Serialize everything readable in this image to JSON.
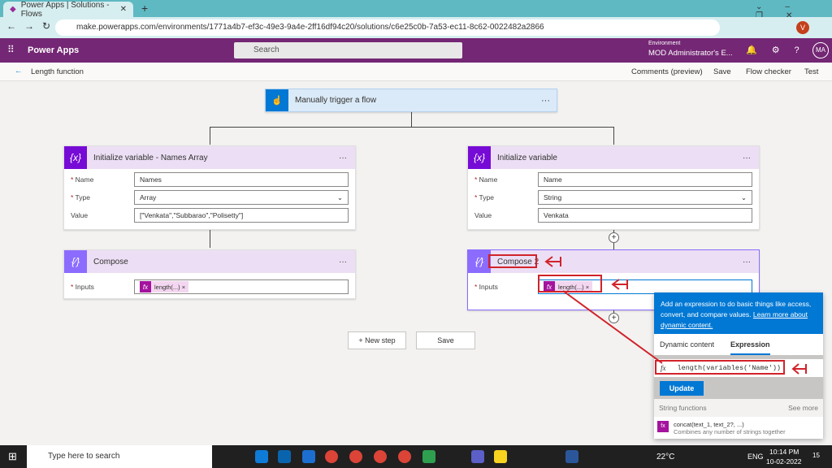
{
  "browser": {
    "tab_title": "Power Apps | Solutions - Flows",
    "url": "make.powerapps.com/environments/1771a4b7-ef3c-49e3-9a4e-2ff16df94c20/solutions/c6e25c0b-7a53-ec11-8c62-0022482a2866",
    "profile": "V"
  },
  "header": {
    "app": "Power Apps",
    "search_placeholder": "Search",
    "env_label": "Environment",
    "env_name": "MOD Administrator's E...",
    "avatar": "MA"
  },
  "subheader": {
    "flow_name": "Length function",
    "comments": "Comments (preview)",
    "save": "Save",
    "checker": "Flow checker",
    "test": "Test"
  },
  "trigger": {
    "title": "Manually trigger a flow"
  },
  "left_var": {
    "title": "Initialize variable - Names Array",
    "name_label": "Name",
    "name": "Names",
    "type_label": "Type",
    "type": "Array",
    "value_label": "Value",
    "value": "[\"Venkata\",\"Subbarao\",\"Polisetty\"]"
  },
  "left_compose": {
    "title": "Compose",
    "inputs_label": "Inputs",
    "token": "length(...)"
  },
  "right_var": {
    "title": "Initialize variable",
    "name_label": "Name",
    "name": "Name",
    "type_label": "Type",
    "type": "String",
    "value_label": "Value",
    "value": "Venkata"
  },
  "right_compose": {
    "title": "Compose 2",
    "inputs_label": "Inputs",
    "token": "length(...)"
  },
  "actions": {
    "new_step": "+ New step",
    "save": "Save"
  },
  "panel": {
    "info": "Add an expression to do basic things like access, convert, and compare values.",
    "link": "Learn more about dynamic content.",
    "tab_dynamic": "Dynamic content",
    "tab_expression": "Expression",
    "expression": "length(variables('Name'))",
    "update": "Update",
    "section": "String functions",
    "see_more": "See more",
    "fn_name": "concat(text_1, text_2?, ...)",
    "fn_desc": "Combines any number of strings together"
  },
  "taskbar": {
    "search": "Type here to search",
    "temp": "22°C",
    "lang": "ENG",
    "time": "10:14 PM",
    "date": "10-02-2022",
    "notif": "15"
  }
}
